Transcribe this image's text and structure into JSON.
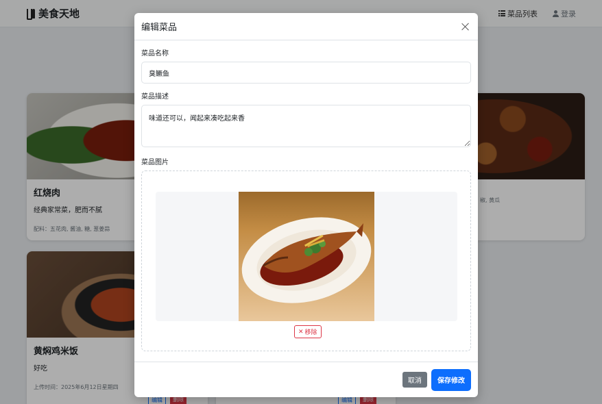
{
  "navbar": {
    "brand": "美食天地",
    "links": [
      {
        "label": "菜品列表",
        "icon": "list-icon"
      },
      {
        "label": "登录",
        "icon": "user-icon"
      }
    ]
  },
  "cards": [
    {
      "title": "红烧肉",
      "desc": "经典家常菜，肥而不腻",
      "meta": "配料：五花肉, 酱油, 糖, 葱姜蒜"
    },
    {
      "title": "",
      "desc": "",
      "meta": "椒, 黄瓜"
    },
    {
      "title": "黄焖鸡米饭",
      "desc": "好吃",
      "meta": "上传时间：2025年6月12日星期四"
    }
  ],
  "card_buttons": {
    "edit": "编辑",
    "delete": "删除"
  },
  "modal": {
    "title": "编辑菜品",
    "name_label": "菜品名称",
    "name_value": "臭鳜鱼",
    "desc_label": "菜品描述",
    "desc_value": "味道还可以，闻起来凑吃起来香",
    "image_label": "菜品图片",
    "remove_label": "移除",
    "cancel_label": "取消",
    "save_label": "保存修改"
  },
  "colors": {
    "primary": "#0d6efd",
    "secondary": "#6c757d",
    "danger": "#dc3545"
  }
}
